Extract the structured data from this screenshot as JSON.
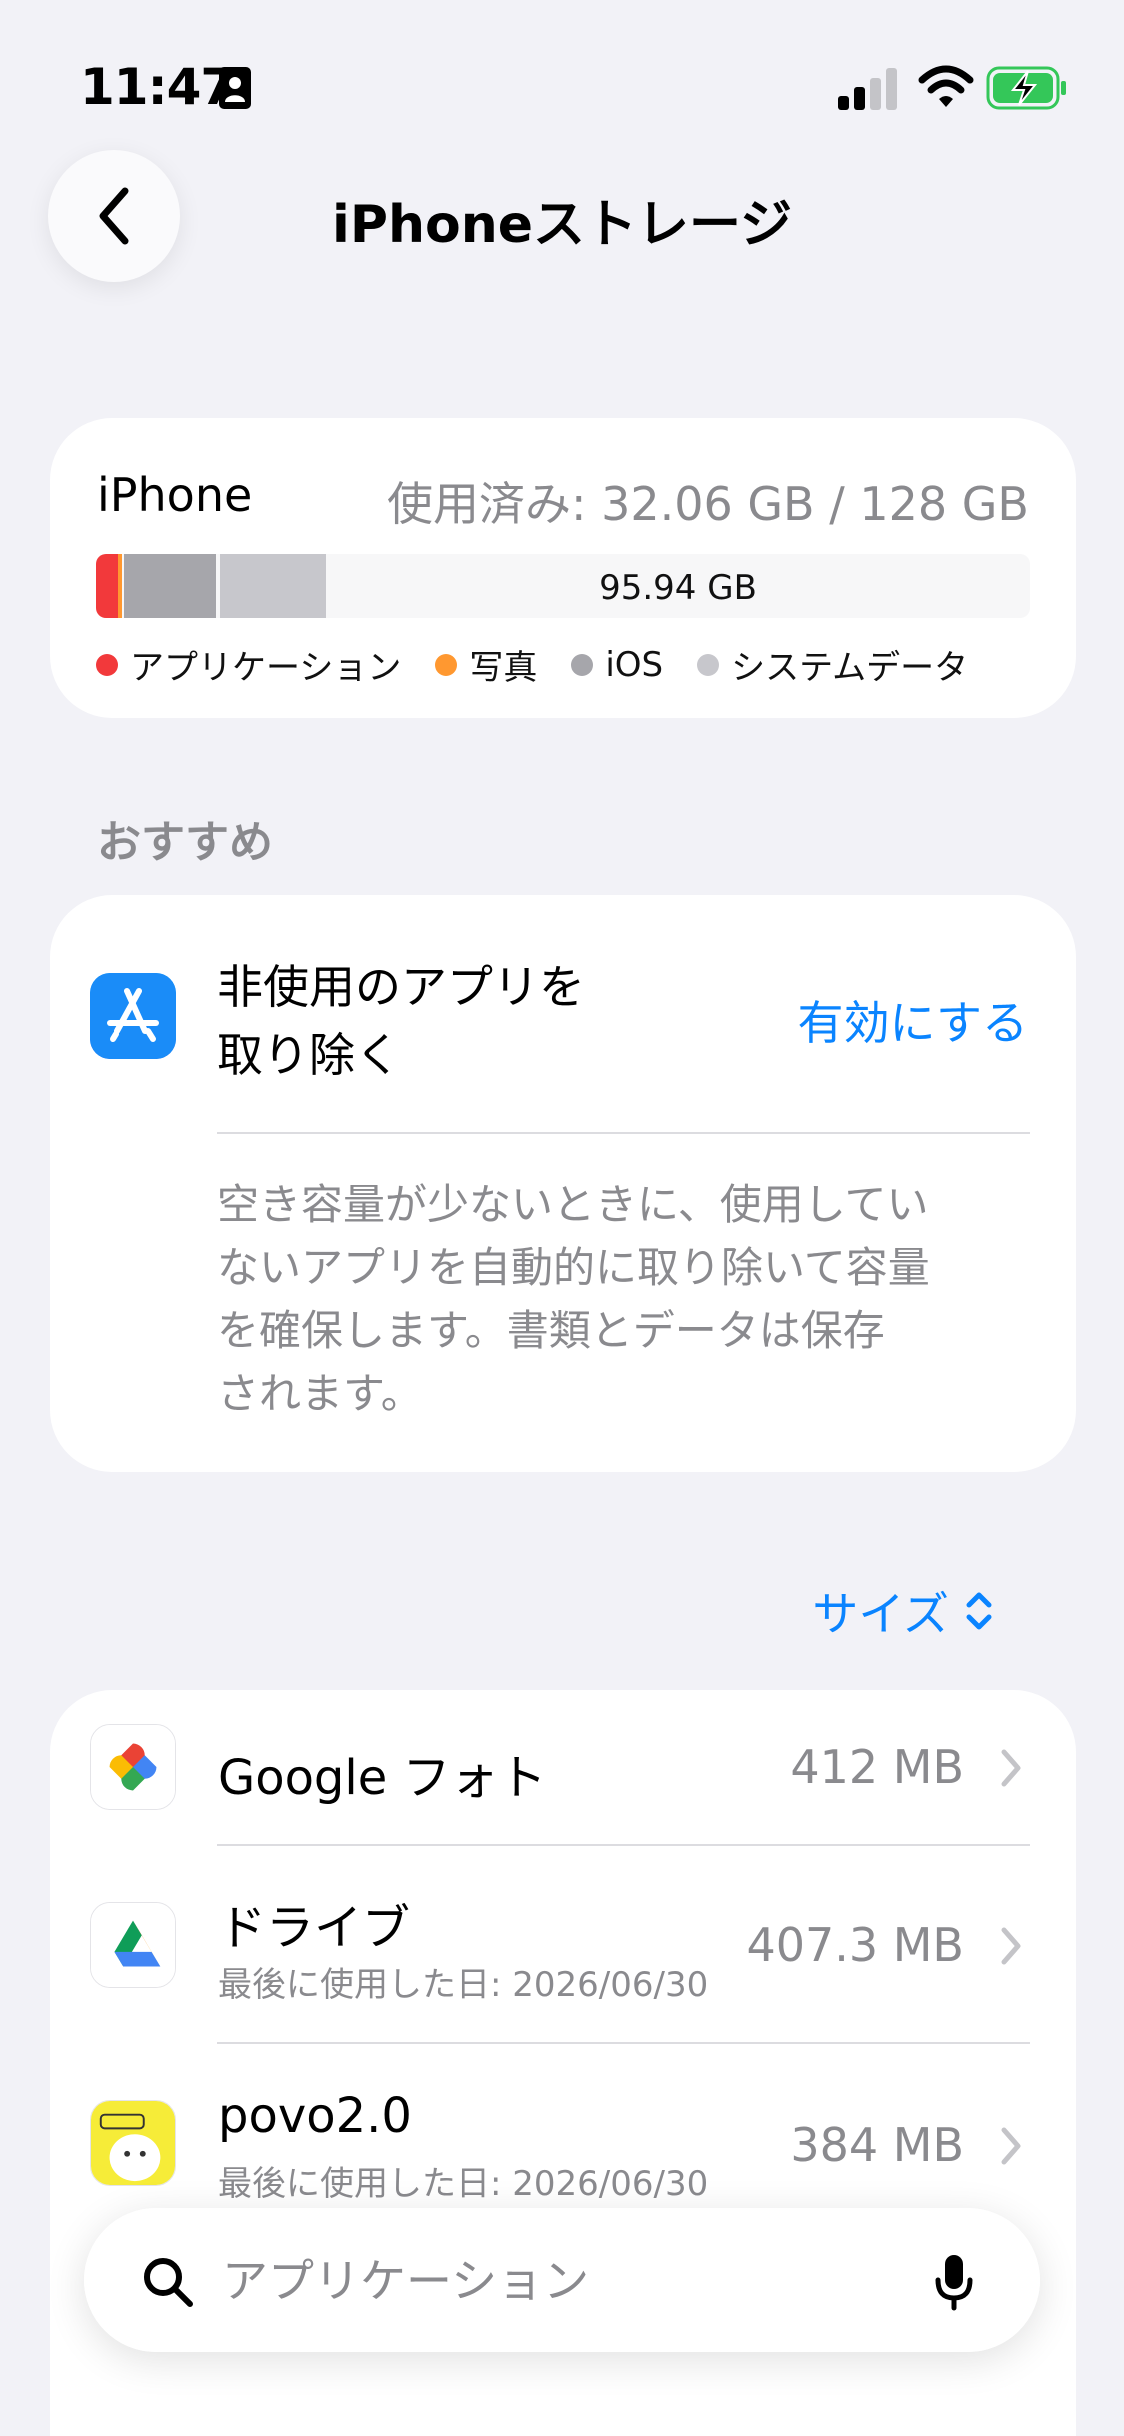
{
  "status_bar": {
    "time": "11:47"
  },
  "header": {
    "title": "iPhoneストレージ"
  },
  "storage": {
    "device": "iPhone",
    "used": "使用済み: 32.06 GB / 128 GB",
    "free": "95.94 GB",
    "legend": [
      {
        "label": "アプリケーション",
        "color": "#f2393b"
      },
      {
        "label": "写真",
        "color": "#ff9830"
      },
      {
        "label": "iOS",
        "color": "#a6a6ab"
      },
      {
        "label": "システムデータ",
        "color": "#c7c7cc"
      }
    ]
  },
  "recommendations": {
    "section_title": "おすすめ",
    "title_line1": "非使用のアプリを",
    "title_line2": "取り除く",
    "action": "有効にする",
    "description_lines": [
      "空き容量が少ないときに、使用してい",
      "ないアプリを自動的に取り除いて容量",
      "を確保します。書類とデータは保存",
      "されます。"
    ]
  },
  "sort": {
    "label": "サイズ"
  },
  "apps": [
    {
      "name": "Google フォト",
      "last_used": "",
      "size": "412 MB"
    },
    {
      "name": "ドライブ",
      "last_used": "最後に使用した日: 2026/06/30",
      "size": "407.3 MB"
    },
    {
      "name": "povo2.0",
      "last_used": "最後に使用した日: 2026/06/30",
      "size": "384 MB"
    }
  ],
  "search": {
    "placeholder": "アプリケーション"
  },
  "colors": {
    "accent": "#0a84ff",
    "background": "#f2f2f7"
  },
  "icons": [
    "id-card-icon",
    "signal-icon",
    "wifi-icon",
    "battery-charging-icon",
    "chevron-left-icon",
    "app-store-icon",
    "sort-icon",
    "google-photos-icon",
    "google-drive-icon",
    "povo-icon",
    "chevron-right-icon",
    "search-icon",
    "microphone-icon"
  ]
}
